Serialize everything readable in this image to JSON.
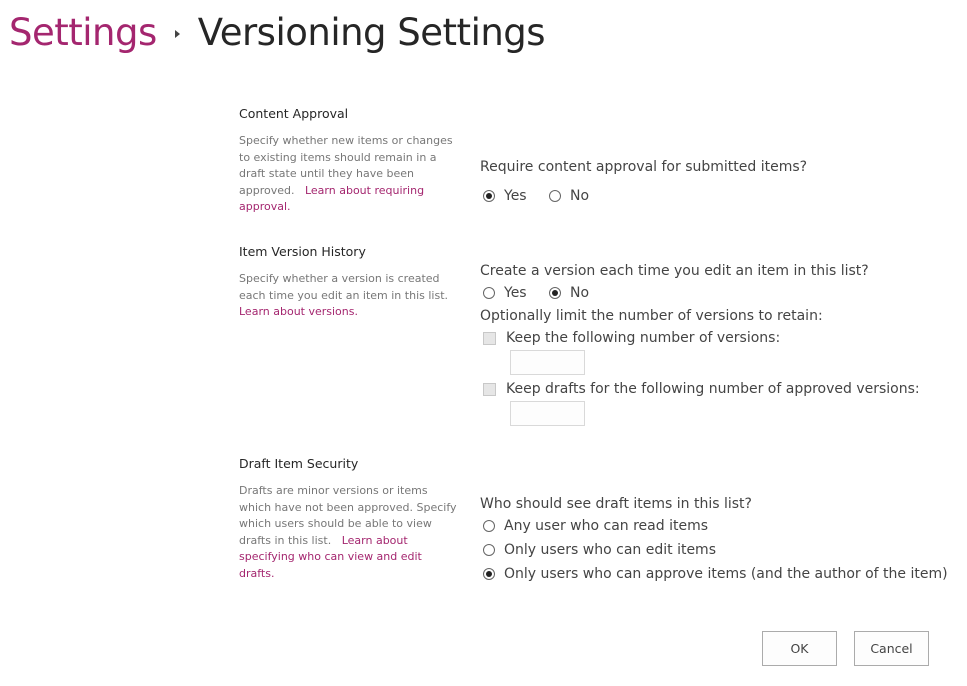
{
  "breadcrumb": {
    "parent": "Settings",
    "separator_icon": "triangle-right-icon",
    "current": "Versioning Settings"
  },
  "colors": {
    "accent": "#a4266f",
    "text": "#444444",
    "muted": "#777777"
  },
  "content_approval": {
    "heading": "Content Approval",
    "description": "Specify whether new items or changes to existing items should remain in a draft state until they have been approved.",
    "link": "Learn about requiring approval.",
    "question": "Require content approval for submitted items?",
    "options": [
      {
        "label": "Yes",
        "checked": true
      },
      {
        "label": "No",
        "checked": false
      }
    ]
  },
  "item_version_history": {
    "heading": "Item Version History",
    "description": "Specify whether a version is created each time you edit an item in this list.",
    "link": "Learn about versions.",
    "question": "Create a version each time you edit an item in this list?",
    "options": [
      {
        "label": "Yes",
        "checked": false
      },
      {
        "label": "No",
        "checked": true
      }
    ],
    "limit_label": "Optionally limit the number of versions to retain:",
    "keep_versions": {
      "label": "Keep the following number of versions:",
      "checked": false,
      "value": ""
    },
    "keep_drafts": {
      "label": "Keep drafts for the following number of approved versions:",
      "checked": false,
      "value": ""
    }
  },
  "draft_item_security": {
    "heading": "Draft Item Security",
    "description": "Drafts are minor versions or items which have not been approved. Specify which users should be able to view drafts in this list.",
    "link": "Learn about specifying who can view and edit drafts.",
    "question": "Who should see draft items in this list?",
    "options": [
      {
        "label": "Any user who can read items",
        "checked": false
      },
      {
        "label": "Only users who can edit items",
        "checked": false
      },
      {
        "label": "Only users who can approve items (and the author of the item)",
        "checked": true
      }
    ]
  },
  "buttons": {
    "ok": "OK",
    "cancel": "Cancel"
  }
}
